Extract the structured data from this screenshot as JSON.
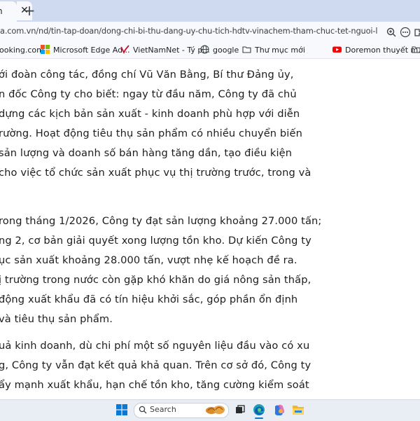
{
  "browser": {
    "tab": {
      "title": "h",
      "close_glyph": "✕"
    },
    "new_tab_glyph": "+",
    "url": "a.com.vn/nd/tin-tap-doan/dong-chi-bi-thu-dang-uy-chu-tich-hdtv-vinachem-tham-chuc-tet-nguoi-lao-dong-cong-ty...",
    "toolbar_icons": [
      "zoom-icon",
      "more-icon",
      "extensions-icon"
    ]
  },
  "bookmarks": [
    {
      "label": "ooking.com",
      "icon": "booking-icon"
    },
    {
      "label": "Microsoft Edge Ad...",
      "icon": "microsoft-icon"
    },
    {
      "label": "VietNamNet - Tý p...",
      "icon": "vietnamnet-icon"
    },
    {
      "label": "google",
      "icon": "globe-icon"
    },
    {
      "label": "Thư mục mới",
      "icon": "folder-icon"
    },
    {
      "label": "Doremon thuyết m...",
      "icon": "youtube-icon"
    }
  ],
  "article": {
    "paragraphs": [
      {
        "lines": [
          "ới đoàn công tác, đồng chí Vũ Văn Bằng, Bí thư Đảng ủy,",
          "n đốc Công ty cho biết: ngay từ đầu năm, Công ty đã chủ",
          "dựng các kịch bản sản xuất - kinh doanh phù hợp với diễn",
          "rường. Hoạt động tiêu thụ sản phẩm có nhiều chuyển biến",
          "sản lượng và doanh số bán hàng tăng dần, tạo điều kiện",
          "cho việc tổ chức sản xuất phục vụ thị trường trước, trong và"
        ]
      },
      {
        "lines": [
          "rong tháng 1/2026, Công ty đạt sản lượng khoảng 27.000 tấn;",
          "ng 2, cơ bản giải quyết xong lượng tồn kho. Dự kiến Công ty",
          "ục sản xuất khoảng 28.000 tấn, vượt nhẹ kế hoạch đề ra.",
          "ị trường trong nước còn gặp khó khăn do giá nông sản thấp,",
          " động xuất khẩu đã có tín hiệu khởi sắc, góp phần ổn định",
          "và tiêu thụ sản phẩm."
        ]
      },
      {
        "lines": [
          "uả kinh doanh, dù chi phí một số nguyên liệu đầu vào có xu",
          "g, Công ty vẫn đạt kết quả khả quan. Trên cơ sở đó, Công ty",
          "ẩy mạnh xuất khẩu, hạn chế tồn kho, tăng cường kiểm soát"
        ]
      }
    ]
  },
  "taskbar": {
    "search_placeholder": "Search",
    "apps": [
      "windows-start-icon",
      "search-icon",
      "task-view-icon",
      "edge-icon",
      "copilot-icon",
      "file-explorer-icon"
    ]
  },
  "colors": {
    "tab_strip": "#cfd9ef",
    "toolbar": "#f7f9fc",
    "text": "#1d1d1d",
    "taskbar": "#e9eef5"
  }
}
